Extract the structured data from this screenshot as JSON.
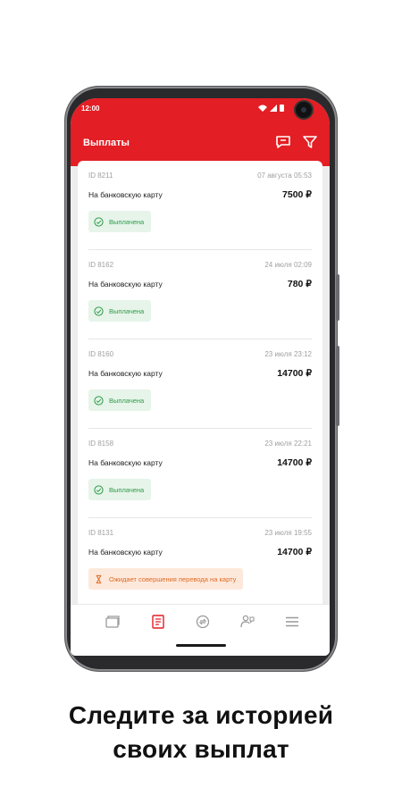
{
  "status": {
    "time": "12:00"
  },
  "header": {
    "title": "Выплаты"
  },
  "payouts": [
    {
      "id": "ID 8211",
      "date": "07 августа 05:53",
      "type": "На банковскую карту",
      "amount": "7500 ₽",
      "status": "Выплачена",
      "state": "ok"
    },
    {
      "id": "ID 8162",
      "date": "24 июля 02:09",
      "type": "На банковскую карту",
      "amount": "780 ₽",
      "status": "Выплачена",
      "state": "ok"
    },
    {
      "id": "ID 8160",
      "date": "23 июля 23:12",
      "type": "На банковскую карту",
      "amount": "14700 ₽",
      "status": "Выплачена",
      "state": "ok"
    },
    {
      "id": "ID 8158",
      "date": "23 июля 22:21",
      "type": "На банковскую карту",
      "amount": "14700 ₽",
      "status": "Выплачена",
      "state": "ok"
    },
    {
      "id": "ID 8131",
      "date": "23 июля 19:55",
      "type": "На банковскую карту",
      "amount": "14700 ₽",
      "status": "Ожидает совершения перевода на карту",
      "state": "wait"
    }
  ],
  "tabs": [
    "wallet-icon",
    "receipt-icon",
    "exchange-icon",
    "support-icon",
    "menu-icon"
  ],
  "colors": {
    "brand": "#e31e24",
    "success": "#2e9a4a",
    "pending": "#e06a23"
  },
  "caption": {
    "line1": "Следите за историей",
    "line2": "своих выплат"
  }
}
